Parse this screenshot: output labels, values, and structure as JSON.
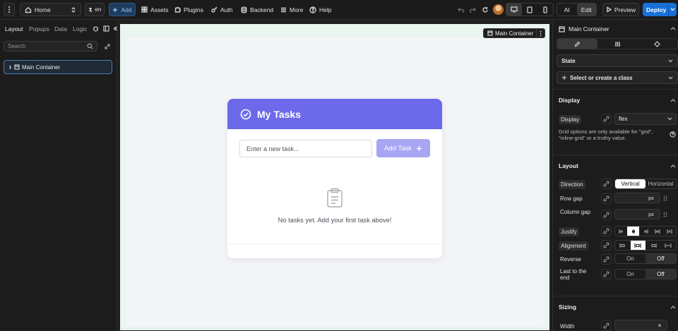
{
  "topbar": {
    "page": "Home",
    "lang": "en",
    "add": "Add",
    "assets": "Assets",
    "plugins": "Plugins",
    "auth": "Auth",
    "backend": "Backend",
    "more": "More",
    "help": "Help",
    "mode_ai": "AI",
    "mode_edit": "Edit",
    "preview": "Preview",
    "deploy": "Deploy",
    "accent": "#1670d8"
  },
  "left_panel": {
    "tabs": [
      "Layout",
      "Popups",
      "Data",
      "Logic"
    ],
    "search_placeholder": "Search",
    "tree": [
      {
        "label": "Main Container"
      }
    ]
  },
  "canvas": {
    "selected_label": "Main Container",
    "app": {
      "title": "My Tasks",
      "input_placeholder": "Enter a new task...",
      "add_button": "Add Task",
      "empty_message": "No tasks yet. Add your first task above!",
      "header_color": "#6c69ea"
    }
  },
  "right_panel": {
    "title": "Main Container",
    "state_label": "State",
    "class_label": "Select or create a class",
    "display_section": {
      "title": "Display",
      "display_label": "Display",
      "display_value": "flex",
      "note": "Grid options are only available for \"grid\", \"inline-grid\" or a truthy value."
    },
    "layout_section": {
      "title": "Layout",
      "direction_label": "Direction",
      "direction_options": [
        "Vertical",
        "Horizontal"
      ],
      "row_gap_label": "Row gap",
      "row_gap_unit": "px",
      "column_gap_label": "Column gap",
      "column_gap_unit": "px",
      "justify_label": "Justify",
      "alignment_label": "Alignment",
      "reverse_label": "Reverse",
      "reverse_options": [
        "On",
        "Off"
      ],
      "last_to_end_label": "Last to the end",
      "last_to_end_options": [
        "On",
        "Off"
      ]
    },
    "sizing_section": {
      "title": "Sizing",
      "width_label": "Width",
      "width_unit": "a"
    }
  }
}
